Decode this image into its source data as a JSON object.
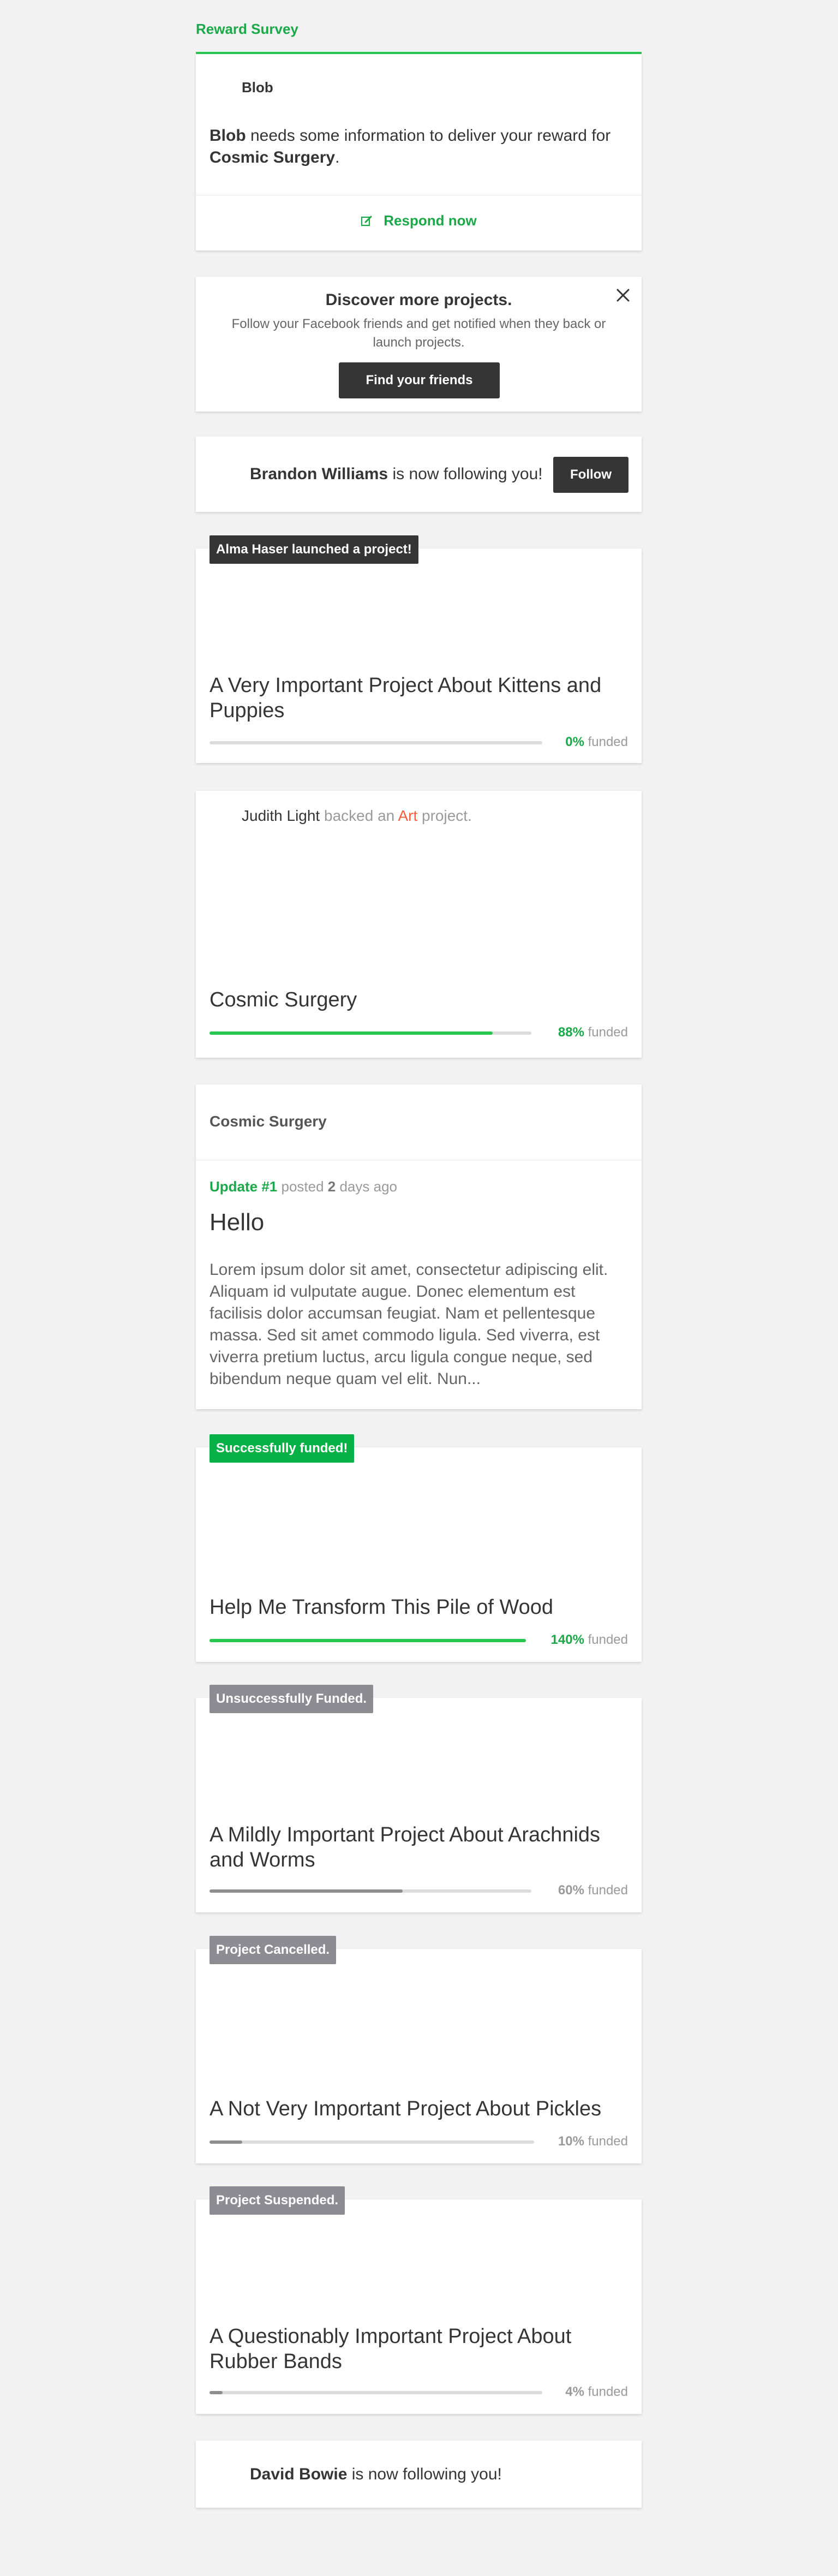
{
  "survey": {
    "header": "Reward Survey",
    "creator": "Blob",
    "text_creator": "Blob",
    "text_middle": " needs some information to deliver your reward for ",
    "text_project": "Cosmic Surgery",
    "text_end": ".",
    "respond_label": "Respond now",
    "respond_icon": "edit-icon"
  },
  "discover": {
    "title": "Discover more projects.",
    "subtitle": "Follow your Facebook friends and get notified when they back or launch projects.",
    "button": "Find your friends",
    "close_icon": "close-icon"
  },
  "follow1": {
    "name": "Brandon Williams",
    "text": " is now following you!",
    "button": "Follow"
  },
  "project1": {
    "badge": "Alma Haser launched a project!",
    "title": "A Very Important Project About Kittens and Puppies",
    "percent": "0%",
    "percent_value": 0,
    "funded_label": " funded"
  },
  "backed": {
    "name": "Judith Light",
    "text1": " backed an ",
    "category": "Art",
    "text2": " project.",
    "title": "Cosmic Surgery",
    "percent": "88%",
    "percent_value": 88,
    "funded_label": " funded"
  },
  "update": {
    "project": "Cosmic Surgery",
    "label": "Update #1",
    "posted": " posted ",
    "count": "2",
    "ago": " days ago",
    "title": "Hello",
    "body": "Lorem ipsum dolor sit amet, consectetur adipiscing elit. Aliquam id vulputate augue. Donec elementum est facilisis dolor accumsan feugiat. Nam et pellentesque massa. Sed sit amet commodo ligula. Sed viverra, est viverra pretium luctus, arcu ligula congue neque, sed bibendum neque quam vel elit. Nun..."
  },
  "project2": {
    "badge": "Successfully funded!",
    "title": "Help Me Transform This Pile of Wood",
    "percent": "140%",
    "percent_value": 140,
    "funded_label": " funded"
  },
  "project3": {
    "badge": "Unsuccessfully Funded.",
    "title": "A Mildly Important Project About Arachnids and Worms",
    "percent": "60%",
    "percent_value": 60,
    "funded_label": " funded"
  },
  "project4": {
    "badge": "Project Cancelled.",
    "title": "A Not Very Important Project About Pickles",
    "percent": "10%",
    "percent_value": 10,
    "funded_label": " funded"
  },
  "project5": {
    "badge": "Project Suspended.",
    "title": "A Questionably Important Project About Rubber Bands",
    "percent": "4%",
    "percent_value": 4,
    "funded_label": " funded"
  },
  "follow2": {
    "name": "David Bowie",
    "text": " is now following you!"
  },
  "colors": {
    "accent_green": "#25c74f",
    "badge_green": "#07b146",
    "badge_grey": "#8c8c92",
    "art_orange": "#f45f3b",
    "dark_button": "#353535"
  }
}
